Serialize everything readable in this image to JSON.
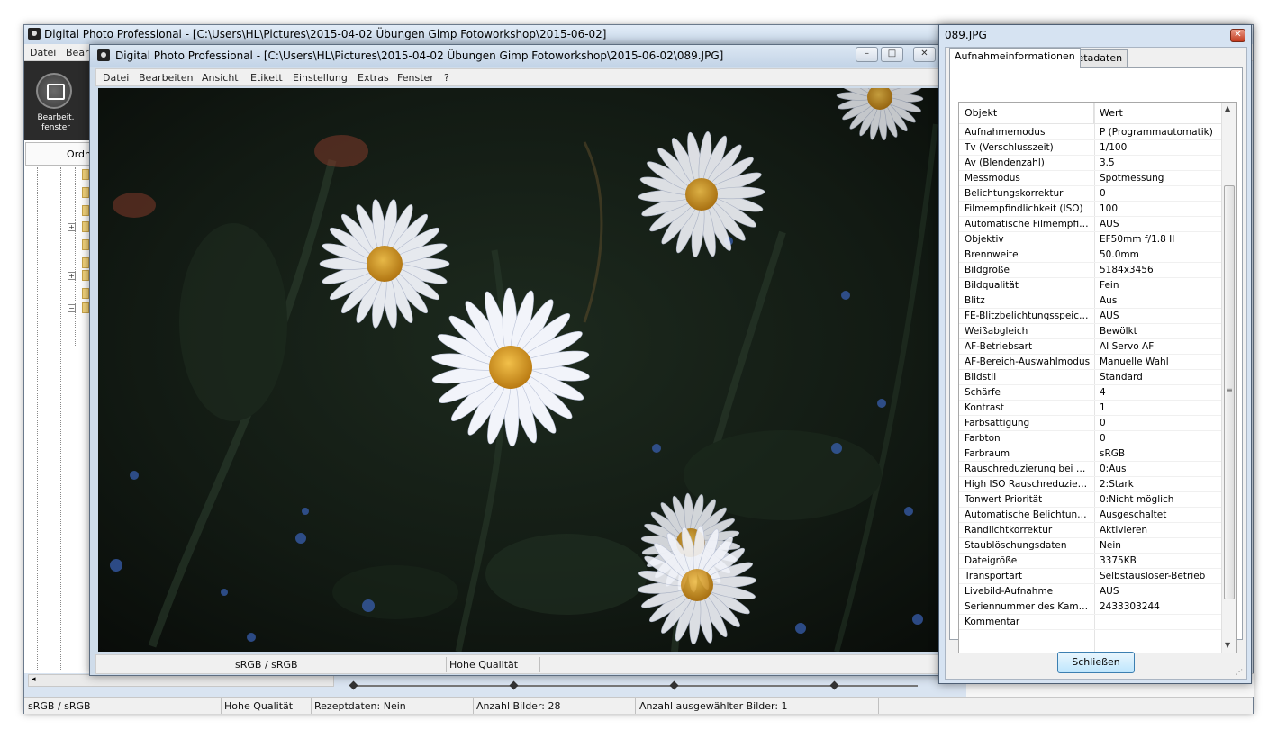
{
  "main_window": {
    "title": "Digital Photo Professional - [C:\\Users\\HL\\Pictures\\2015-04-02 Übungen  Gimp Fotoworkshop\\2015-06-02]",
    "menu": [
      "Datei",
      "Bear"
    ],
    "toolbar": {
      "edit_window_label": "Bearbeit.\nfenster"
    },
    "folder_panel": {
      "header": "Ordn"
    },
    "status": {
      "color_space": "sRGB / sRGB",
      "quality": "Hohe Qualität",
      "recipe": "Rezeptdaten: Nein",
      "image_count": "Anzahl Bilder: 28",
      "selected_count": "Anzahl ausgewählter Bilder: 1"
    }
  },
  "viewer_window": {
    "title": "Digital Photo Professional - [C:\\Users\\HL\\Pictures\\2015-04-02 Übungen  Gimp Fotoworkshop\\2015-06-02\\089.JPG]",
    "menu": [
      "Datei",
      "Bearbeiten",
      "Ansicht",
      "Etikett",
      "Einstellung",
      "Extras",
      "Fenster",
      "?"
    ],
    "status": {
      "color_space": "sRGB / sRGB",
      "quality": "Hohe Qualität"
    },
    "window_buttons": {
      "minimize": "–",
      "restore": "□",
      "close": "✕"
    }
  },
  "info_dialog": {
    "title": "089.JPG",
    "tabs": [
      "Aufnahmeinformationen",
      "Metadaten"
    ],
    "active_tab": 0,
    "columns": [
      "Objekt",
      "Wert"
    ],
    "rows": [
      [
        "Aufnahmemodus",
        "P (Programmautomatik)"
      ],
      [
        "Tv (Verschlusszeit)",
        "1/100"
      ],
      [
        "Av (Blendenzahl)",
        "3.5"
      ],
      [
        "Messmodus",
        "Spotmessung"
      ],
      [
        "Belichtungskorrektur",
        "0"
      ],
      [
        "Filmempfindlichkeit (ISO)",
        "100"
      ],
      [
        "Automatische Filmempfindli...",
        "AUS"
      ],
      [
        "Objektiv",
        "EF50mm f/1.8 II"
      ],
      [
        "Brennweite",
        "50.0mm"
      ],
      [
        "Bildgröße",
        "5184x3456"
      ],
      [
        "Bildqualität",
        "Fein"
      ],
      [
        "Blitz",
        "Aus"
      ],
      [
        "FE-Blitzbelichtungsspeicher...",
        "AUS"
      ],
      [
        "Weißabgleich",
        "Bewölkt"
      ],
      [
        "AF-Betriebsart",
        "AI Servo AF"
      ],
      [
        "AF-Bereich-Auswahlmodus",
        "Manuelle  Wahl"
      ],
      [
        "Bildstil",
        "Standard"
      ],
      [
        "Schärfe",
        "4"
      ],
      [
        "Kontrast",
        "1"
      ],
      [
        "Farbsättigung",
        "0"
      ],
      [
        "Farbton",
        "0"
      ],
      [
        "Farbraum",
        "sRGB"
      ],
      [
        "Rauschreduzierung bei Lan...",
        "0:Aus"
      ],
      [
        "High ISO Rauschreduzierung",
        "2:Stark"
      ],
      [
        "Tonwert Priorität",
        "0:Nicht möglich"
      ],
      [
        "Automatische Belichtungso...",
        "Ausgeschaltet"
      ],
      [
        "Randlichtkorrektur",
        "Aktivieren"
      ],
      [
        "Staublöschungsdaten",
        "Nein"
      ],
      [
        "Dateigröße",
        "3375KB"
      ],
      [
        "Transportart",
        "Selbstauslöser-Betrieb"
      ],
      [
        "Livebild-Aufnahme",
        "AUS"
      ],
      [
        "Seriennummer des Kamera...",
        "2433303244"
      ],
      [
        "Kommentar",
        ""
      ]
    ],
    "close_button": "Schließen"
  },
  "colors": {
    "photo_bg": "#0f1410",
    "petal": "#f2f4fa",
    "center": "#d99a1c",
    "accent_button": "#bee6fd"
  }
}
